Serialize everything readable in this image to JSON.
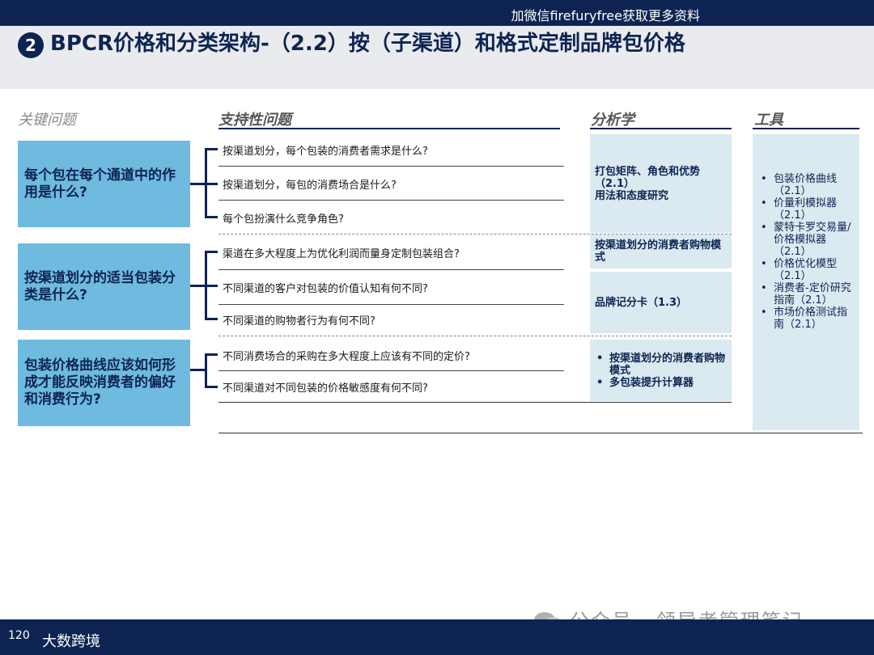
{
  "banner": "加微信firefuryfree获取更多资料",
  "title_number": "2",
  "title": "BPCR价格和分类架构-（2.2）按（子渠道）和格式定制品牌包价格",
  "columns": {
    "key_questions": "关键问题",
    "supporting": "支持性问题",
    "analytics": "分析学",
    "tools": "工具"
  },
  "key_questions": [
    "每个包在每个通道中的作用是什么?",
    "按渠道划分的适当包装分类是什么?",
    "包装价格曲线应该如何形成才能反映消费者的偏好和消费行为?"
  ],
  "supporting_questions": [
    "按渠道划分，每个包装的消费者需求是什么?",
    "按渠道划分，每包的消费场合是什么?",
    "每个包扮演什么竞争角色?",
    "渠道在多大程度上为优化利润而量身定制包装组合?",
    "不同渠道的客户对包装的价值认知有何不同?",
    "不同渠道的购物者行为有何不同?",
    "不同消费场合的采购在多大程度上应该有不同的定价?",
    "不同渠道对不同包装的价格敏感度有何不同?"
  ],
  "analytics": {
    "box1_line1": "打包矩阵、角色和优势",
    "box1_line2": "（2.1）",
    "box1_line3": "用法和态度研究",
    "box2": "按渠道划分的消费者购物模式",
    "box3": "品牌记分卡（1.3）",
    "box4_items": [
      "按渠道划分的消费者购物模式",
      "多包装提升计算器"
    ]
  },
  "tools": [
    "包装价格曲线（2.1）",
    "价量利模拟器（2.1）",
    "蒙特卡罗交易量/价格模拟器（2.1）",
    "价格优化模型（2.1）",
    "消费者-定价研究指南（2.1）",
    "市场价格测试指南（2.1）"
  ],
  "footer": {
    "page": "120",
    "logo": "大数跨境",
    "watermark": "公众号 · 领导者管理笔记"
  }
}
